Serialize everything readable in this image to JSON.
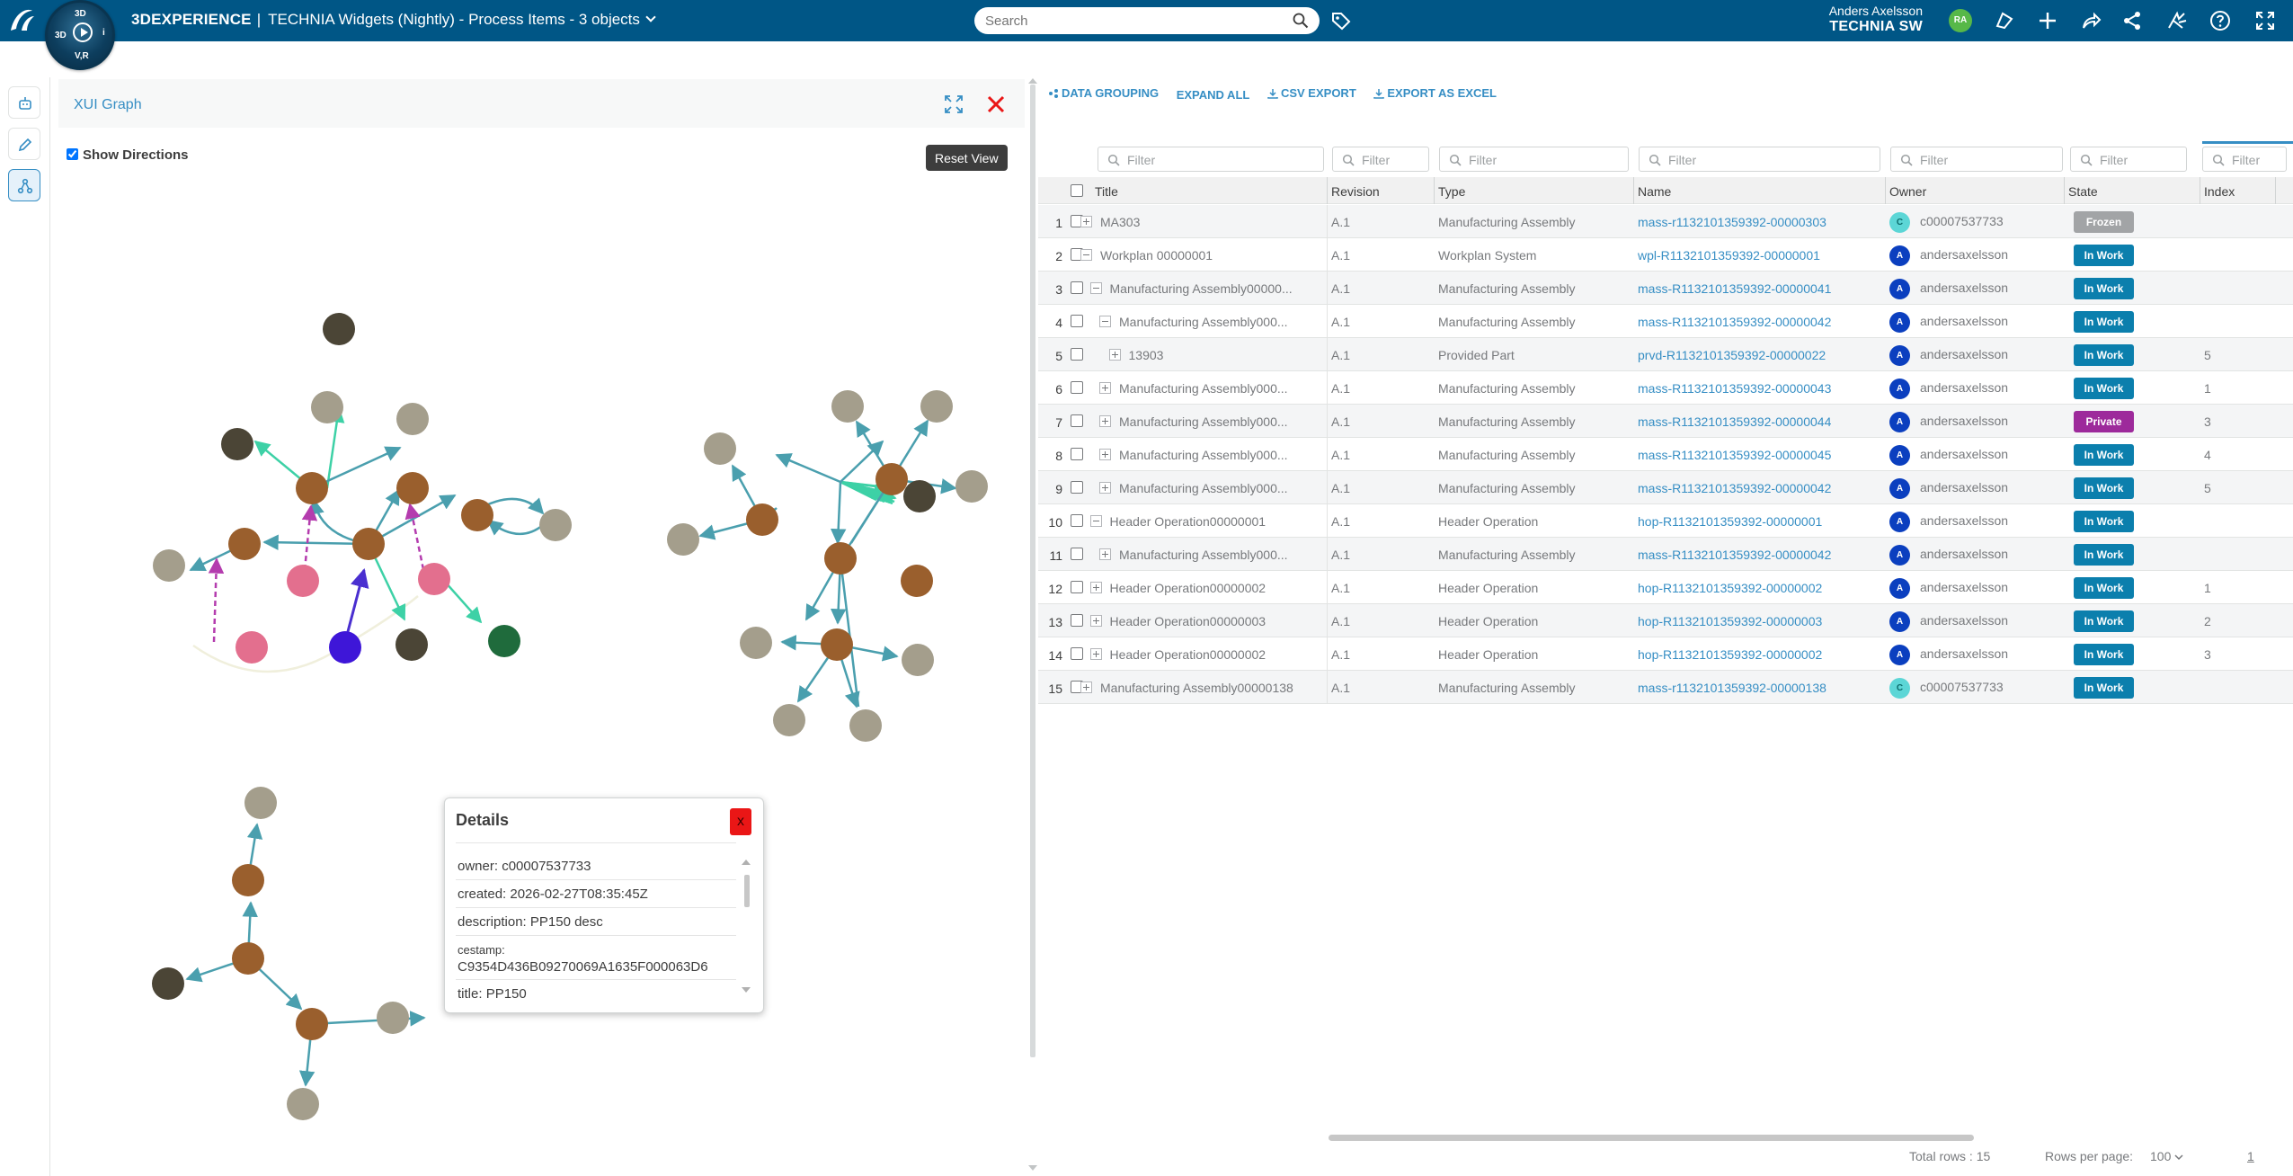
{
  "topbar": {
    "brand": "3DEXPERIENCE",
    "separator": "|",
    "title": "TECHNIA Widgets (Nightly) - Process Items - 3 objects",
    "search_placeholder": "Search",
    "user_name": "Anders Axelsson",
    "user_org": "TECHNIA SW",
    "user_initials": "RA",
    "compass_labels": {
      "top": "3D",
      "right": "i",
      "bottom": "V,R",
      "left": "3D"
    }
  },
  "left_rail": [
    "widget-icon",
    "pencil-icon",
    "graph-icon"
  ],
  "graph": {
    "title": "XUI Graph",
    "show_directions_label": "Show Directions",
    "show_directions_checked": true,
    "reset_view_label": "Reset View"
  },
  "details": {
    "title": "Details",
    "close_label": "x",
    "rows": [
      {
        "key": "owner:",
        "value": "c00007537733"
      },
      {
        "key": "created:",
        "value": "2026-02-27T08:35:45Z"
      },
      {
        "key": "description:",
        "value": "PP150 desc"
      },
      {
        "key": "cestamp:",
        "value": "C9354D436B09270069A1635F000063D6"
      },
      {
        "key": "title:",
        "value": "PP150"
      }
    ]
  },
  "toolbar": {
    "data_grouping": "DATA GROUPING",
    "expand_all": "EXPAND ALL",
    "csv_export": "CSV EXPORT",
    "export_excel": "EXPORT AS EXCEL"
  },
  "filter_placeholder": "Filter",
  "columns": [
    "Title",
    "Revision",
    "Type",
    "Name",
    "Owner",
    "State",
    "Index"
  ],
  "rows": [
    {
      "n": "1",
      "depth": 0,
      "toggle": "plus",
      "title": "MA303",
      "rev": "A.1",
      "type": "Manufacturing Assembly",
      "name": "mass-r1132101359392-00000303",
      "av": "C",
      "owner": "c00007537733",
      "state": "Frozen",
      "idx": ""
    },
    {
      "n": "2",
      "depth": 0,
      "toggle": "minus",
      "title": "Workplan 00000001",
      "rev": "A.1",
      "type": "Workplan System",
      "name": "wpl-R1132101359392-00000001",
      "av": "A",
      "owner": "andersaxelsson",
      "state": "In Work",
      "idx": ""
    },
    {
      "n": "3",
      "depth": 1,
      "toggle": "minus",
      "title": "Manufacturing Assembly00000...",
      "rev": "A.1",
      "type": "Manufacturing Assembly",
      "name": "mass-R1132101359392-00000041",
      "av": "A",
      "owner": "andersaxelsson",
      "state": "In Work",
      "idx": ""
    },
    {
      "n": "4",
      "depth": 2,
      "toggle": "minus",
      "title": "Manufacturing Assembly000...",
      "rev": "A.1",
      "type": "Manufacturing Assembly",
      "name": "mass-R1132101359392-00000042",
      "av": "A",
      "owner": "andersaxelsson",
      "state": "In Work",
      "idx": ""
    },
    {
      "n": "5",
      "depth": 3,
      "toggle": "plus",
      "title": "13903",
      "rev": "A.1",
      "type": "Provided Part",
      "name": "prvd-R1132101359392-00000022",
      "av": "A",
      "owner": "andersaxelsson",
      "state": "In Work",
      "idx": "5"
    },
    {
      "n": "6",
      "depth": 2,
      "toggle": "plus",
      "title": "Manufacturing Assembly000...",
      "rev": "A.1",
      "type": "Manufacturing Assembly",
      "name": "mass-R1132101359392-00000043",
      "av": "A",
      "owner": "andersaxelsson",
      "state": "In Work",
      "idx": "1"
    },
    {
      "n": "7",
      "depth": 2,
      "toggle": "plus",
      "title": "Manufacturing Assembly000...",
      "rev": "A.1",
      "type": "Manufacturing Assembly",
      "name": "mass-R1132101359392-00000044",
      "av": "A",
      "owner": "andersaxelsson",
      "state": "Private",
      "idx": "3"
    },
    {
      "n": "8",
      "depth": 2,
      "toggle": "plus",
      "title": "Manufacturing Assembly000...",
      "rev": "A.1",
      "type": "Manufacturing Assembly",
      "name": "mass-R1132101359392-00000045",
      "av": "A",
      "owner": "andersaxelsson",
      "state": "In Work",
      "idx": "4"
    },
    {
      "n": "9",
      "depth": 2,
      "toggle": "plus",
      "title": "Manufacturing Assembly000...",
      "rev": "A.1",
      "type": "Manufacturing Assembly",
      "name": "mass-R1132101359392-00000042",
      "av": "A",
      "owner": "andersaxelsson",
      "state": "In Work",
      "idx": "5"
    },
    {
      "n": "10",
      "depth": 1,
      "toggle": "minus",
      "title": "Header Operation00000001",
      "rev": "A.1",
      "type": "Header Operation",
      "name": "hop-R1132101359392-00000001",
      "av": "A",
      "owner": "andersaxelsson",
      "state": "In Work",
      "idx": ""
    },
    {
      "n": "11",
      "depth": 2,
      "toggle": "plus",
      "title": "Manufacturing Assembly000...",
      "rev": "A.1",
      "type": "Manufacturing Assembly",
      "name": "mass-R1132101359392-00000042",
      "av": "A",
      "owner": "andersaxelsson",
      "state": "In Work",
      "idx": ""
    },
    {
      "n": "12",
      "depth": 1,
      "toggle": "plus",
      "title": "Header Operation00000002",
      "rev": "A.1",
      "type": "Header Operation",
      "name": "hop-R1132101359392-00000002",
      "av": "A",
      "owner": "andersaxelsson",
      "state": "In Work",
      "idx": "1"
    },
    {
      "n": "13",
      "depth": 1,
      "toggle": "plus",
      "title": "Header Operation00000003",
      "rev": "A.1",
      "type": "Header Operation",
      "name": "hop-R1132101359392-00000003",
      "av": "A",
      "owner": "andersaxelsson",
      "state": "In Work",
      "idx": "2"
    },
    {
      "n": "14",
      "depth": 1,
      "toggle": "plus",
      "title": "Header Operation00000002",
      "rev": "A.1",
      "type": "Header Operation",
      "name": "hop-R1132101359392-00000002",
      "av": "A",
      "owner": "andersaxelsson",
      "state": "In Work",
      "idx": "3"
    },
    {
      "n": "15",
      "depth": 0,
      "toggle": "plus",
      "title": "Manufacturing Assembly00000138",
      "rev": "A.1",
      "type": "Manufacturing Assembly",
      "name": "mass-r1132101359392-00000138",
      "av": "C",
      "owner": "c00007537733",
      "state": "In Work",
      "idx": ""
    }
  ],
  "footer": {
    "total_rows": "Total rows : 15",
    "rows_per_page_label": "Rows per page:",
    "rows_per_page_value": "100",
    "page": "1"
  },
  "colors": {
    "topbar": "#005686",
    "accent": "#368ec4",
    "in_work": "#0b7fad",
    "frozen": "#a2a4a6",
    "private": "#9d2a9b",
    "avatar_a": "#0b3fbf",
    "avatar_c": "#5cd6d6"
  }
}
